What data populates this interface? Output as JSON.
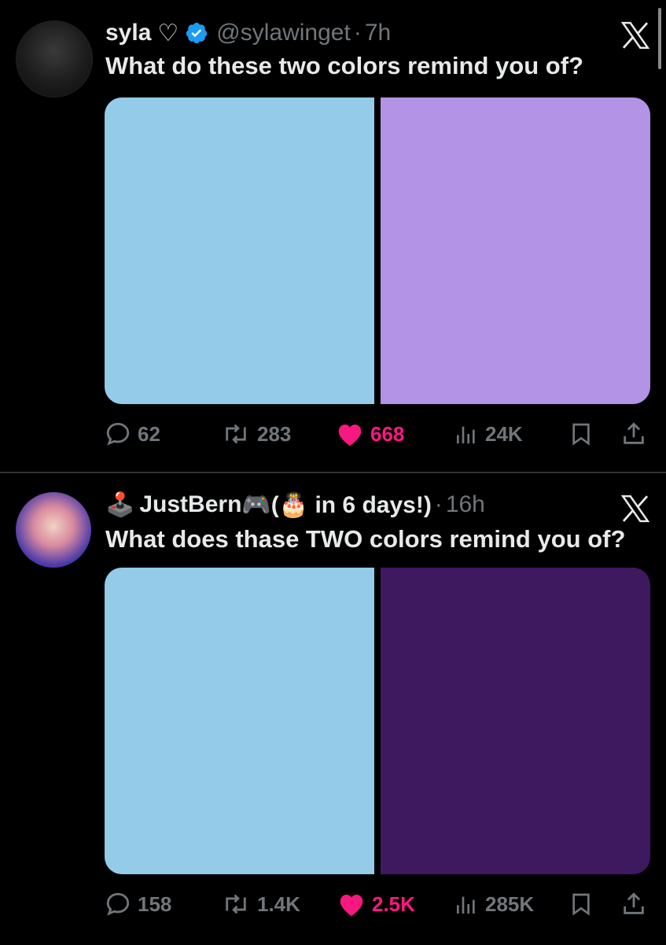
{
  "tweets": [
    {
      "author": {
        "name": "syla",
        "name_suffix": "♡",
        "handle": "@sylawinget",
        "verified": true
      },
      "time": "7h",
      "separator": "·",
      "text": "What do these two  colors remind you of?",
      "media": {
        "left_color": "#94cbe9",
        "right_color": "#b293e6"
      },
      "stats": {
        "replies": "62",
        "reposts": "283",
        "likes": "668",
        "views": "24K"
      }
    },
    {
      "author": {
        "name": "JustBern",
        "name_prefix": "🕹️",
        "name_suffix": "🎮(🎂 in 6 days!)",
        "handle": "",
        "verified": false
      },
      "time": "16h",
      "separator": "·",
      "text": "What does thase TWO colors remind you of?",
      "media": {
        "left_color": "#94cbe9",
        "right_color": "#3e1960"
      },
      "stats": {
        "replies": "158",
        "reposts": "1.4K",
        "likes": "2.5K",
        "views": "285K"
      }
    }
  ],
  "icons": {
    "reply": "reply-icon",
    "repost": "repost-icon",
    "like": "heart-filled-icon",
    "views": "views-icon",
    "bookmark": "bookmark-icon",
    "share": "share-icon",
    "close": "x-logo-icon"
  },
  "colors": {
    "like": "#f91880",
    "muted": "#71767b",
    "verified": "#1d9bf0",
    "text": "#e7e9ea"
  }
}
